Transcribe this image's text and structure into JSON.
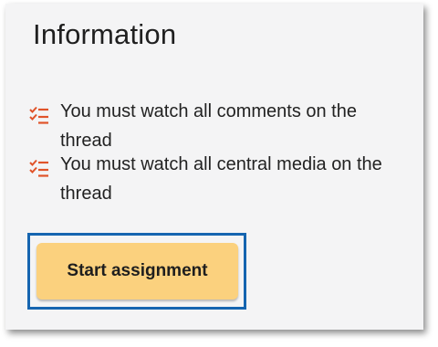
{
  "panel": {
    "title": "Information",
    "requirements": [
      {
        "icon": "checklist-icon",
        "text": "You must watch all comments on the thread"
      },
      {
        "icon": "checklist-icon",
        "text": "You must watch all central media on the thread"
      }
    ],
    "start_button_label": "Start assignment"
  },
  "colors": {
    "panel_background": "#f4f4f5",
    "icon_accent": "#e0542a",
    "button_background": "#fbd17e",
    "focus_ring": "#1565b0"
  }
}
